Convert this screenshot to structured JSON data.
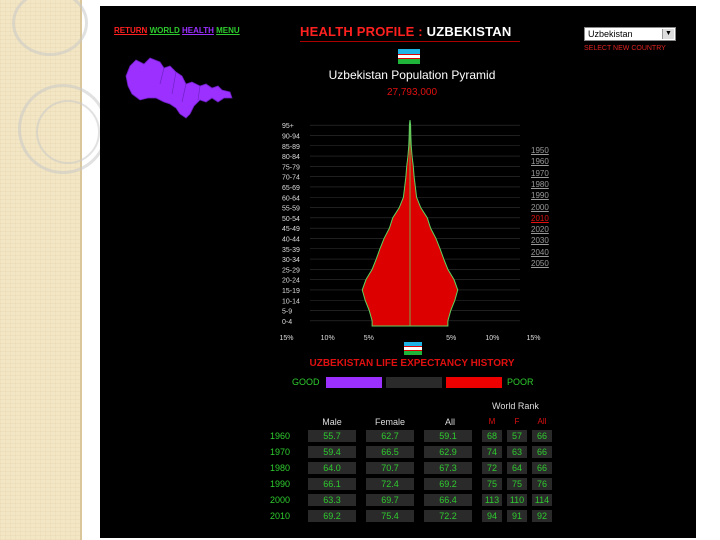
{
  "nav": {
    "return": "RETURN",
    "world": "WORLD",
    "health": "HEALTH",
    "menu": "MENU"
  },
  "header": {
    "title_prefix": "HEALTH PROFILE :",
    "title_country": "UZBEKISTAN"
  },
  "country_select": {
    "value": "Uzbekistan",
    "note": "SELECT NEW COUNTRY"
  },
  "pyramid": {
    "title": "Uzbekistan Population Pyramid",
    "population": "27,793,000",
    "age_groups": [
      "95+",
      "90-94",
      "85-89",
      "80-84",
      "75-79",
      "70-74",
      "65-69",
      "60-64",
      "55-59",
      "50-54",
      "45-49",
      "40-44",
      "35-39",
      "30-34",
      "25-29",
      "20-24",
      "15-19",
      "10-14",
      "5-9",
      "0-4"
    ],
    "percent_share_by_age": [
      0.1,
      0.2,
      0.3,
      0.5,
      0.8,
      1.0,
      1.3,
      1.6,
      2.6,
      4.2,
      5.0,
      6.3,
      7.3,
      8.2,
      9.2,
      10.7,
      11.6,
      10.9,
      9.9,
      9.2
    ],
    "xticks": [
      "15%",
      "10%",
      "5%",
      "",
      "5%",
      "10%",
      "15%"
    ],
    "xtick_values": [
      15,
      10,
      5,
      0,
      5,
      10,
      15
    ],
    "years": [
      {
        "label": "1950",
        "selected": false
      },
      {
        "label": "1960",
        "selected": false
      },
      {
        "label": "1970",
        "selected": false
      },
      {
        "label": "1980",
        "selected": false
      },
      {
        "label": "1990",
        "selected": false
      },
      {
        "label": "2000",
        "selected": false
      },
      {
        "label": "2010",
        "selected": true
      },
      {
        "label": "2020",
        "selected": false
      },
      {
        "label": "2030",
        "selected": false
      },
      {
        "label": "2040",
        "selected": false
      },
      {
        "label": "2050",
        "selected": false
      }
    ]
  },
  "life_expectancy": {
    "title": "UZBEKISTAN LIFE EXPECTANCY HISTORY",
    "legend": {
      "good": "GOOD",
      "poor": "POOR",
      "colors": [
        "#9b30ff",
        "#2a2a2a",
        "#ee0000"
      ]
    },
    "world_rank_label": "World Rank",
    "headers": {
      "male": "Male",
      "female": "Female",
      "all": "All",
      "m": "M",
      "f": "F",
      "a": "All"
    },
    "rows": [
      {
        "year": "1960",
        "male": "55.7",
        "female": "62.7",
        "all": "59.1",
        "rm": "68",
        "rf": "57",
        "ra": "66"
      },
      {
        "year": "1970",
        "male": "59.4",
        "female": "66.5",
        "all": "62.9",
        "rm": "74",
        "rf": "63",
        "ra": "66"
      },
      {
        "year": "1980",
        "male": "64.0",
        "female": "70.7",
        "all": "67.3",
        "rm": "72",
        "rf": "64",
        "ra": "66"
      },
      {
        "year": "1990",
        "male": "66.1",
        "female": "72.4",
        "all": "69.2",
        "rm": "75",
        "rf": "75",
        "ra": "76"
      },
      {
        "year": "2000",
        "male": "63.3",
        "female": "69.7",
        "all": "66.4",
        "rm": "113",
        "rf": "110",
        "ra": "114"
      },
      {
        "year": "2010",
        "male": "69.2",
        "female": "75.4",
        "all": "72.2",
        "rm": "94",
        "rf": "91",
        "ra": "92"
      }
    ]
  },
  "colors": {
    "accent_red": "#e01010",
    "green": "#2ecc2e",
    "purple": "#9b30ff",
    "pyramid_fill": "#dd0000",
    "pyramid_stroke": "#5fd35f"
  }
}
